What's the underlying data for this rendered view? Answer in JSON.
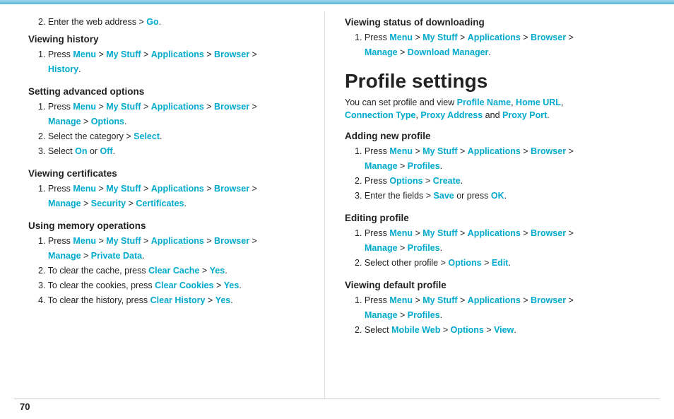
{
  "top_bar": {},
  "left": {
    "intro": {
      "text": "2. Enter the web address > ",
      "go": "Go",
      "suffix": "."
    },
    "sections": [
      {
        "id": "viewing-history",
        "title": "Viewing history",
        "steps": [
          {
            "num": "1.",
            "parts": [
              {
                "text": "Press "
              },
              {
                "link": "Menu",
                "cyan": true
              },
              {
                "text": " > "
              },
              {
                "link": "My Stuff",
                "cyan": true
              },
              {
                "text": " > "
              },
              {
                "link": "Applications",
                "cyan": true
              },
              {
                "text": " > "
              },
              {
                "link": "Browser",
                "cyan": true
              },
              {
                "text": " > "
              }
            ],
            "line2parts": [
              {
                "link": "History",
                "cyan": true
              },
              {
                "text": "."
              }
            ]
          }
        ]
      },
      {
        "id": "setting-advanced",
        "title": "Setting advanced options",
        "steps": [
          {
            "num": "1.",
            "parts": [
              {
                "text": "Press "
              },
              {
                "link": "Menu",
                "cyan": true
              },
              {
                "text": " > "
              },
              {
                "link": "My Stuff",
                "cyan": true
              },
              {
                "text": " > "
              },
              {
                "link": "Applications",
                "cyan": true
              },
              {
                "text": " > "
              },
              {
                "link": "Browser",
                "cyan": true
              },
              {
                "text": " > "
              }
            ],
            "line2parts": [
              {
                "link": "Manage",
                "cyan": true
              },
              {
                "text": " > "
              },
              {
                "link": "Options",
                "cyan": true
              },
              {
                "text": "."
              }
            ]
          },
          {
            "num": "2.",
            "parts": [
              {
                "text": "Select the category > "
              },
              {
                "link": "Select",
                "cyan": true
              },
              {
                "text": "."
              }
            ]
          },
          {
            "num": "3.",
            "parts": [
              {
                "text": "Select "
              },
              {
                "link": "On",
                "cyan": true
              },
              {
                "text": " or "
              },
              {
                "link": "Off",
                "cyan": true
              },
              {
                "text": "."
              }
            ]
          }
        ]
      },
      {
        "id": "viewing-certificates",
        "title": "Viewing certificates",
        "steps": [
          {
            "num": "1.",
            "parts": [
              {
                "text": "Press "
              },
              {
                "link": "Menu",
                "cyan": true
              },
              {
                "text": " > "
              },
              {
                "link": "My Stuff",
                "cyan": true
              },
              {
                "text": " > "
              },
              {
                "link": "Applications",
                "cyan": true
              },
              {
                "text": " > "
              },
              {
                "link": "Browser",
                "cyan": true
              },
              {
                "text": " > "
              }
            ],
            "line2parts": [
              {
                "link": "Manage",
                "cyan": true
              },
              {
                "text": " > "
              },
              {
                "link": "Security",
                "cyan": true
              },
              {
                "text": " > "
              },
              {
                "link": "Certificates",
                "cyan": true
              },
              {
                "text": "."
              }
            ]
          }
        ]
      },
      {
        "id": "using-memory",
        "title": "Using memory operations",
        "steps": [
          {
            "num": "1.",
            "parts": [
              {
                "text": "Press "
              },
              {
                "link": "Menu",
                "cyan": true
              },
              {
                "text": " > "
              },
              {
                "link": "My Stuff",
                "cyan": true
              },
              {
                "text": " > "
              },
              {
                "link": "Applications",
                "cyan": true
              },
              {
                "text": " > "
              },
              {
                "link": "Browser",
                "cyan": true
              },
              {
                "text": " > "
              }
            ],
            "line2parts": [
              {
                "link": "Manage",
                "cyan": true
              },
              {
                "text": " > "
              },
              {
                "link": "Private Data",
                "cyan": true
              },
              {
                "text": "."
              }
            ]
          },
          {
            "num": "2.",
            "parts": [
              {
                "text": "To clear the cache, press "
              },
              {
                "link": "Clear Cache",
                "cyan": true
              },
              {
                "text": " > "
              },
              {
                "link": "Yes",
                "cyan": true
              },
              {
                "text": "."
              }
            ]
          },
          {
            "num": "3.",
            "parts": [
              {
                "text": "To clear the cookies, press "
              },
              {
                "link": "Clear Cookies",
                "cyan": true
              },
              {
                "text": " > "
              },
              {
                "link": "Yes",
                "cyan": true
              },
              {
                "text": "."
              }
            ]
          },
          {
            "num": "4.",
            "parts": [
              {
                "text": "To clear the history, press "
              },
              {
                "link": "Clear History",
                "cyan": true
              },
              {
                "text": " > "
              },
              {
                "link": "Yes",
                "cyan": true
              },
              {
                "text": "."
              }
            ]
          }
        ]
      }
    ]
  },
  "right": {
    "viewing_status": {
      "title": "Viewing status of downloading",
      "steps": [
        {
          "num": "1.",
          "parts": [
            {
              "text": "Press "
            },
            {
              "link": "Menu",
              "cyan": true
            },
            {
              "text": " > "
            },
            {
              "link": "My Stuff",
              "cyan": true
            },
            {
              "text": " > "
            },
            {
              "link": "Applications",
              "cyan": true
            },
            {
              "text": " > "
            },
            {
              "link": "Browser",
              "cyan": true
            },
            {
              "text": " > "
            }
          ],
          "line2parts": [
            {
              "link": "Manage",
              "cyan": true
            },
            {
              "text": " > "
            },
            {
              "link": "Download Manager",
              "cyan": true
            },
            {
              "text": "."
            }
          ]
        }
      ]
    },
    "profile_heading": "Profile settings",
    "profile_desc_parts": [
      {
        "text": "You can set profile and view "
      },
      {
        "link": "Profile Name",
        "cyan": true
      },
      {
        "text": ", "
      },
      {
        "link": "Home URL",
        "cyan": true
      },
      {
        "text": ", "
      },
      {
        "link": "Connection Type",
        "cyan": true
      },
      {
        "text": ", "
      },
      {
        "link": "Proxy Address",
        "cyan": true
      },
      {
        "text": " and "
      },
      {
        "link": "Proxy Port",
        "cyan": true
      },
      {
        "text": "."
      }
    ],
    "sections": [
      {
        "id": "adding-new-profile",
        "title": "Adding new profile",
        "steps": [
          {
            "num": "1.",
            "parts": [
              {
                "text": "Press "
              },
              {
                "link": "Menu",
                "cyan": true
              },
              {
                "text": " > "
              },
              {
                "link": "My Stuff",
                "cyan": true
              },
              {
                "text": " > "
              },
              {
                "link": "Applications",
                "cyan": true
              },
              {
                "text": " > "
              },
              {
                "link": "Browser",
                "cyan": true
              },
              {
                "text": " > "
              }
            ],
            "line2parts": [
              {
                "link": "Manage",
                "cyan": true
              },
              {
                "text": " > "
              },
              {
                "link": "Profiles",
                "cyan": true
              },
              {
                "text": "."
              }
            ]
          },
          {
            "num": "2.",
            "parts": [
              {
                "text": "Press "
              },
              {
                "link": "Options",
                "cyan": true
              },
              {
                "text": " > "
              },
              {
                "link": "Create",
                "cyan": true
              },
              {
                "text": "."
              }
            ]
          },
          {
            "num": "3.",
            "parts": [
              {
                "text": "Enter the fields > "
              },
              {
                "link": "Save",
                "cyan": true
              },
              {
                "text": " or press "
              },
              {
                "link": "OK",
                "cyan": true
              },
              {
                "text": "."
              }
            ]
          }
        ]
      },
      {
        "id": "editing-profile",
        "title": "Editing profile",
        "steps": [
          {
            "num": "1.",
            "parts": [
              {
                "text": "Press "
              },
              {
                "link": "Menu",
                "cyan": true
              },
              {
                "text": " > "
              },
              {
                "link": "My Stuff",
                "cyan": true
              },
              {
                "text": " > "
              },
              {
                "link": "Applications",
                "cyan": true
              },
              {
                "text": " > "
              },
              {
                "link": "Browser",
                "cyan": true
              },
              {
                "text": " > "
              }
            ],
            "line2parts": [
              {
                "link": "Manage",
                "cyan": true
              },
              {
                "text": " > "
              },
              {
                "link": "Profiles",
                "cyan": true
              },
              {
                "text": "."
              }
            ]
          },
          {
            "num": "2.",
            "parts": [
              {
                "text": "Select other profile > "
              },
              {
                "link": "Options",
                "cyan": true
              },
              {
                "text": " > "
              },
              {
                "link": "Edit",
                "cyan": true
              },
              {
                "text": "."
              }
            ]
          }
        ]
      },
      {
        "id": "viewing-default-profile",
        "title": "Viewing default profile",
        "steps": [
          {
            "num": "1.",
            "parts": [
              {
                "text": "Press "
              },
              {
                "link": "Menu",
                "cyan": true
              },
              {
                "text": " > "
              },
              {
                "link": "My Stuff",
                "cyan": true
              },
              {
                "text": " > "
              },
              {
                "link": "Applications",
                "cyan": true
              },
              {
                "text": " > "
              },
              {
                "link": "Browser",
                "cyan": true
              },
              {
                "text": " > "
              }
            ],
            "line2parts": [
              {
                "link": "Manage",
                "cyan": true
              },
              {
                "text": " > "
              },
              {
                "link": "Profiles",
                "cyan": true
              },
              {
                "text": "."
              }
            ]
          },
          {
            "num": "2.",
            "parts": [
              {
                "text": "Select "
              },
              {
                "link": "Mobile Web",
                "cyan": true
              },
              {
                "text": " > "
              },
              {
                "link": "Options",
                "cyan": true
              },
              {
                "text": " > "
              },
              {
                "link": "View",
                "cyan": true
              },
              {
                "text": "."
              }
            ]
          }
        ]
      }
    ]
  },
  "footer": {
    "page_number": "70"
  }
}
